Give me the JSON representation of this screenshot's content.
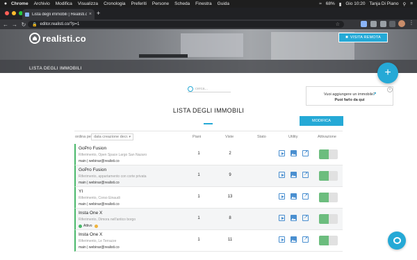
{
  "menubar": {
    "apple": "",
    "items": [
      "Chrome",
      "Archivio",
      "Modifica",
      "Visualizza",
      "Cronologia",
      "Preferiti",
      "Persone",
      "Scheda",
      "Finestra",
      "Guida"
    ],
    "battery": "68%",
    "clock": "Gio 10:20",
    "user": "Tanja Di Piano"
  },
  "browser": {
    "tab_title": "Lista degli immobili | Realisti.co",
    "url": "editor.realisti.co/?p=1",
    "traffic_colors": [
      "#ff5f57",
      "#febc2e",
      "#28c840"
    ]
  },
  "header": {
    "logo_text": "realisti.co",
    "visit_button": "VISITA REMOTA",
    "section_title": "LISTA DEGLI IMMOBILI",
    "add_button": "+"
  },
  "search": {
    "placeholder": "cerca..."
  },
  "tip": {
    "line1": "Vuoi aggiungere un immobile?",
    "line2": "Puoi farlo da qui",
    "close": "×"
  },
  "page": {
    "title": "LISTA DEGLI IMMOBILI",
    "modifica_button": "MODIFICA",
    "sort_label": "ordina per",
    "sort_value": "data creazione decr."
  },
  "columns": {
    "piani": "Piani",
    "viste": "Viste",
    "stato": "Stato",
    "utility": "Utility",
    "attivazione": "Attivazione"
  },
  "rows": [
    {
      "name": "GoPro Fusion",
      "ref": "Riferimento, Open Space Largo San Nazaro",
      "owner": "main | webinar@realisti.co",
      "piani": "1",
      "viste": "2"
    },
    {
      "name": "GoPro Fusion",
      "ref": "Riferimento, appartamento con corte privata",
      "owner": "main | webinar@realisti.co",
      "piani": "1",
      "viste": "9"
    },
    {
      "name": "YI",
      "ref": "Riferimento, Corso Einaudi",
      "owner": "main | webinar@realisti.co",
      "piani": "1",
      "viste": "13"
    },
    {
      "name": "Insta One X",
      "ref": "Riferimento, Dimora nell'antico borgo",
      "owner": "main | webinar@realisti.co",
      "piani": "1",
      "viste": "8",
      "status": "Attivo"
    },
    {
      "name": "Insta One X",
      "ref": "Riferimento, Le Terrazze",
      "owner": "main | webinar@realisti.co",
      "piani": "1",
      "viste": "11"
    }
  ],
  "colors": {
    "accent": "#25a9d6",
    "toggle_on": "#6cbd7e",
    "row_marker": "#49b86a"
  }
}
